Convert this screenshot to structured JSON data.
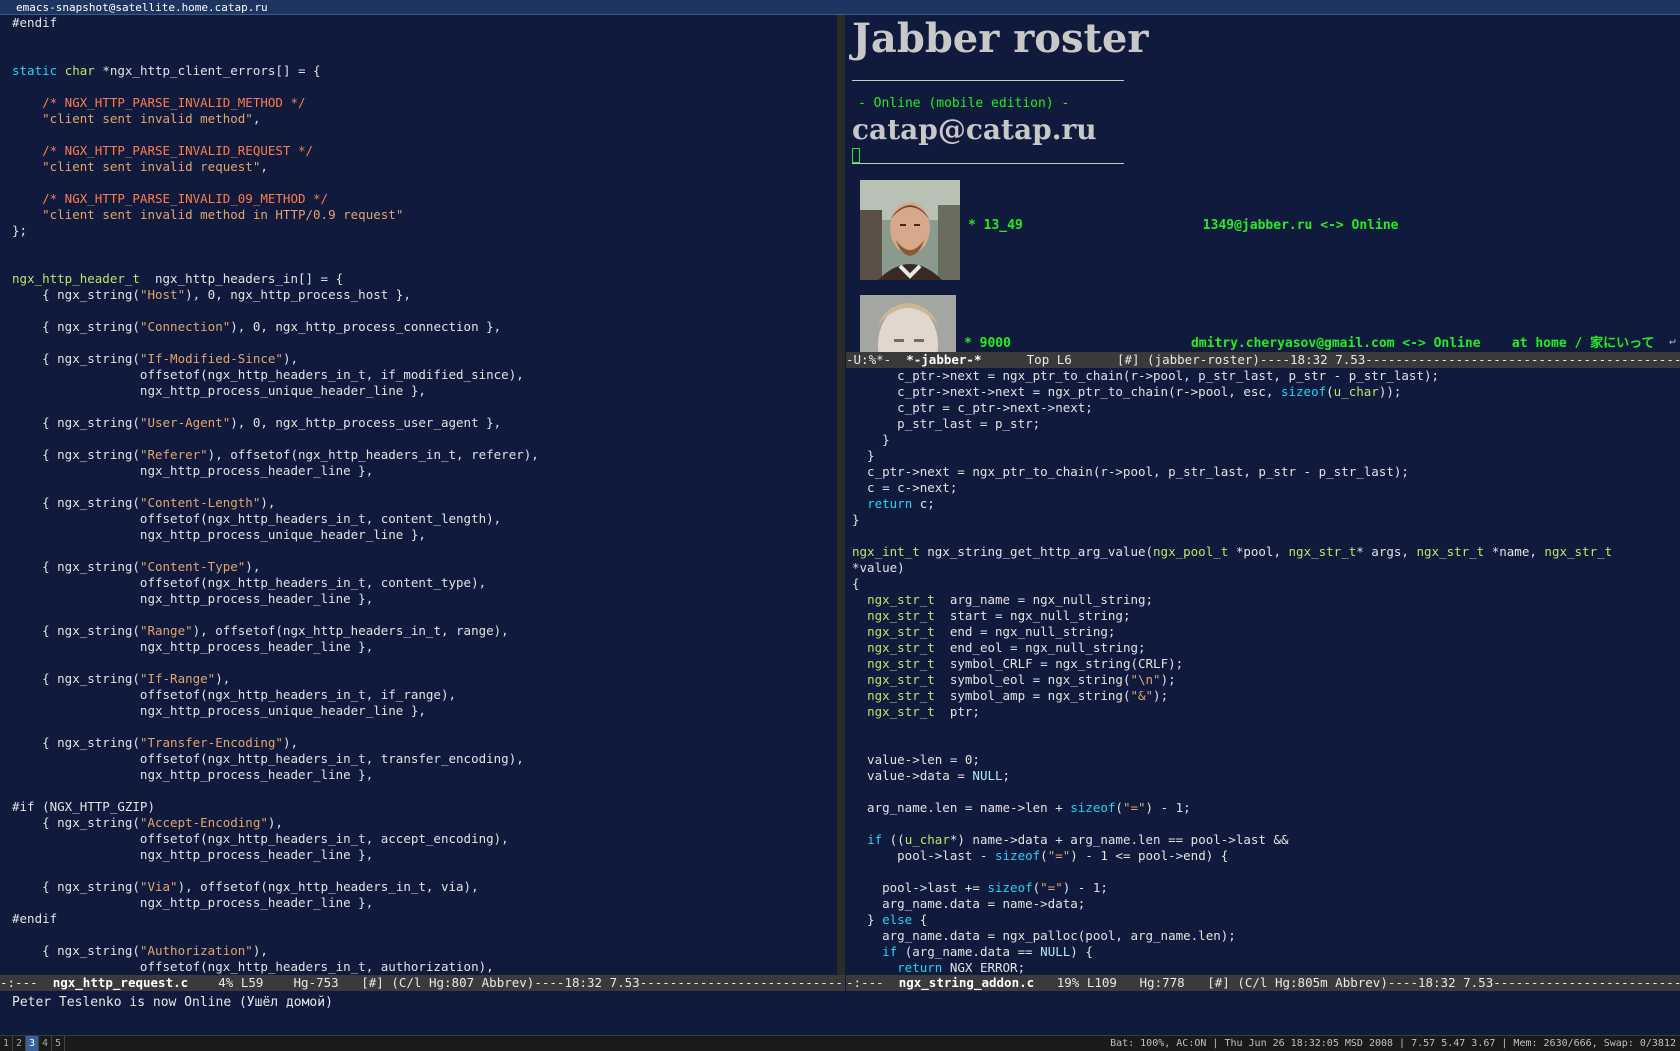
{
  "window_title": "emacs-snapshot@satellite.home.catap.ru",
  "left_buffer": {
    "lines": [
      "#endif",
      "",
      "",
      "static char *ngx_http_client_errors[] = {",
      "",
      "    /* NGX_HTTP_PARSE_INVALID_METHOD */",
      "    \"client sent invalid method\",",
      "",
      "    /* NGX_HTTP_PARSE_INVALID_REQUEST */",
      "    \"client sent invalid request\",",
      "",
      "    /* NGX_HTTP_PARSE_INVALID_09_METHOD */",
      "    \"client sent invalid method in HTTP/0.9 request\"",
      "};",
      "",
      "",
      "ngx_http_header_t  ngx_http_headers_in[] = {",
      "    { ngx_string(\"Host\"), 0, ngx_http_process_host },",
      "",
      "    { ngx_string(\"Connection\"), 0, ngx_http_process_connection },",
      "",
      "    { ngx_string(\"If-Modified-Since\"),",
      "                 offsetof(ngx_http_headers_in_t, if_modified_since),",
      "                 ngx_http_process_unique_header_line },",
      "",
      "    { ngx_string(\"User-Agent\"), 0, ngx_http_process_user_agent },",
      "",
      "    { ngx_string(\"Referer\"), offsetof(ngx_http_headers_in_t, referer),",
      "                 ngx_http_process_header_line },",
      "",
      "    { ngx_string(\"Content-Length\"),",
      "                 offsetof(ngx_http_headers_in_t, content_length),",
      "                 ngx_http_process_unique_header_line },",
      "",
      "    { ngx_string(\"Content-Type\"),",
      "                 offsetof(ngx_http_headers_in_t, content_type),",
      "                 ngx_http_process_header_line },",
      "",
      "    { ngx_string(\"Range\"), offsetof(ngx_http_headers_in_t, range),",
      "                 ngx_http_process_header_line },",
      "",
      "    { ngx_string(\"If-Range\"),",
      "                 offsetof(ngx_http_headers_in_t, if_range),",
      "                 ngx_http_process_unique_header_line },",
      "",
      "    { ngx_string(\"Transfer-Encoding\"),",
      "                 offsetof(ngx_http_headers_in_t, transfer_encoding),",
      "                 ngx_http_process_header_line },",
      "",
      "#if (NGX_HTTP_GZIP)",
      "    { ngx_string(\"Accept-Encoding\"),",
      "                 offsetof(ngx_http_headers_in_t, accept_encoding),",
      "                 ngx_http_process_header_line },",
      "",
      "    { ngx_string(\"Via\"), offsetof(ngx_http_headers_in_t, via),",
      "                 ngx_http_process_header_line },",
      "#endif",
      "",
      "    { ngx_string(\"Authorization\"),",
      "                 offsetof(ngx_http_headers_in_t, authorization),"
    ],
    "modeline": "-:---  ",
    "modeline_name": "ngx_http_request.c",
    "modeline_rest": "    4% L59    Hg-753   [#] (C/l Hg:807 Abbrev)----18:32 7.53---------------------------------------"
  },
  "jabber": {
    "title": "Jabber roster",
    "status": "- Online (mobile edition) -",
    "account": "catap@catap.ru",
    "contacts": [
      {
        "line": "* 13_49                       1349@jabber.ru <-> Online"
      },
      {
        "line": "* 9000                       dmitry.cheryasov@gmail.com <-> Online    at home / 家にいって"
      }
    ],
    "modeline": "-U:%*-  ",
    "modeline_name": "*-jabber-*",
    "modeline_rest": "      Top L6      [#] (jabber-roster)----18:32 7.53------------------------------------------"
  },
  "right_buffer": {
    "lines": [
      "      c_ptr->next = ngx_ptr_to_chain(r->pool, p_str_last, p_str - p_str_last);",
      "      c_ptr->next->next = ngx_ptr_to_chain(r->pool, esc, sizeof(u_char));",
      "      c_ptr = c_ptr->next->next;",
      "      p_str_last = p_str;",
      "    }",
      "  }",
      "  c_ptr->next = ngx_ptr_to_chain(r->pool, p_str_last, p_str - p_str_last);",
      "  c = c->next;",
      "  return c;",
      "}",
      "",
      "ngx_int_t ngx_string_get_http_arg_value(ngx_pool_t *pool, ngx_str_t* args, ngx_str_t *name, ngx_str_t ",
      "*value)",
      "{",
      "  ngx_str_t  arg_name = ngx_null_string;",
      "  ngx_str_t  start = ngx_null_string;",
      "  ngx_str_t  end = ngx_null_string;",
      "  ngx_str_t  end_eol = ngx_null_string;",
      "  ngx_str_t  symbol_CRLF = ngx_string(CRLF);",
      "  ngx_str_t  symbol_eol = ngx_string(\"\\n\");",
      "  ngx_str_t  symbol_amp = ngx_string(\"&\");",
      "  ngx_str_t  ptr;",
      "",
      "",
      "  value->len = 0;",
      "  value->data = NULL;",
      "",
      "  arg_name.len = name->len + sizeof(\"=\") - 1;",
      "",
      "  if ((u_char*) name->data + arg_name.len == pool->last &&",
      "      pool->last - sizeof(\"=\") - 1 <= pool->end) {",
      "",
      "    pool->last += sizeof(\"=\") - 1;",
      "    arg_name.data = name->data;",
      "  } else {",
      "    arg_name.data = ngx_palloc(pool, arg_name.len);",
      "    if (arg_name.data == NULL) {",
      "      return NGX_ERROR;"
    ],
    "modeline": "-:---  ",
    "modeline_name": "ngx_string_addon.c",
    "modeline_rest": "   19% L109   Hg:778   [#] (C/l Hg:805m Abbrev)----18:32 7.53------------------------------------"
  },
  "echo_area": "Peter Teslenko is now Online (Ушёл домой)",
  "taskbar": {
    "workspaces": [
      "1",
      "2",
      "3",
      "4",
      "5"
    ],
    "active": "3",
    "sysinfo": "Bat: 100%, AC:ON | Thu Jun 26 18:32:05 MSD 2008 | 7.57 5.47 3.67 | Mem: 2630/666, Swap: 0/3812"
  },
  "colors": {
    "background": "#0f1a3d",
    "keyword": "#22d4f5",
    "type": "#b6e86b",
    "string": "#e6a36a",
    "comment": "#ff7b4c",
    "jabber_green": "#22ee22"
  }
}
